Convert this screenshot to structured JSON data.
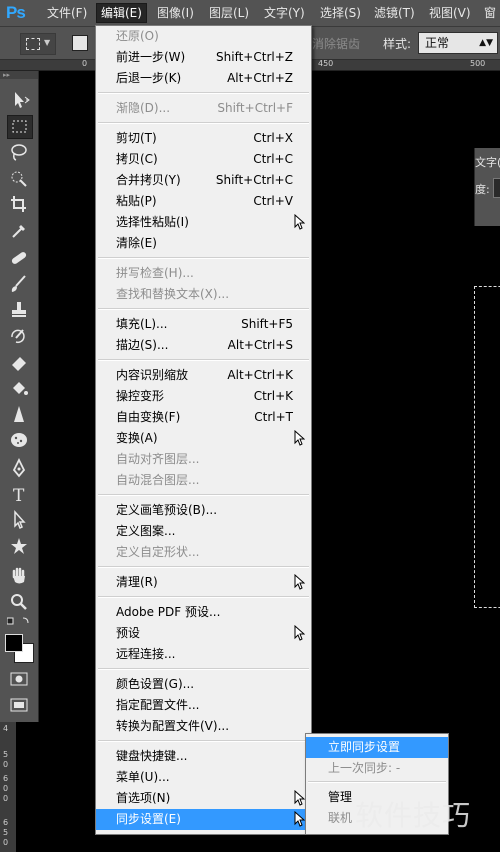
{
  "app": {
    "logo": "Ps"
  },
  "menubar": {
    "items": [
      {
        "label": "文件(F)"
      },
      {
        "label": "编辑(E)"
      },
      {
        "label": "图像(I)"
      },
      {
        "label": "图层(L)"
      },
      {
        "label": "文字(Y)"
      },
      {
        "label": "选择(S)"
      },
      {
        "label": "滤镜(T)"
      },
      {
        "label": "视图(V)"
      },
      {
        "label": "窗"
      }
    ],
    "active": "编辑(E)"
  },
  "options_bar": {
    "antialias_label": "消除锯齿",
    "style_label": "样式:",
    "style_value": "正常"
  },
  "ruler": {
    "marks": [
      "0",
      "450",
      "500"
    ]
  },
  "vertical_ruler": {
    "marks": [
      "4",
      "5",
      "0",
      "6",
      "0",
      "0",
      "6",
      "5",
      "0"
    ]
  },
  "panel_stub": {
    "title": "文字(",
    "field_label": "度:"
  },
  "edit_menu": {
    "items": [
      {
        "label": "还原(O)",
        "shortcut": "",
        "disabled": true
      },
      {
        "label": "前进一步(W)",
        "shortcut": "Shift+Ctrl+Z",
        "disabled": false
      },
      {
        "label": "后退一步(K)",
        "shortcut": "Alt+Ctrl+Z",
        "disabled": false
      },
      {
        "label": "渐隐(D)...",
        "shortcut": "Shift+Ctrl+F",
        "disabled": true
      },
      {
        "label": "剪切(T)",
        "shortcut": "Ctrl+X",
        "disabled": false
      },
      {
        "label": "拷贝(C)",
        "shortcut": "Ctrl+C",
        "disabled": false
      },
      {
        "label": "合并拷贝(Y)",
        "shortcut": "Shift+Ctrl+C",
        "disabled": false
      },
      {
        "label": "粘贴(P)",
        "shortcut": "Ctrl+V",
        "disabled": false
      },
      {
        "label": "选择性粘贴(I)",
        "shortcut": "",
        "disabled": false,
        "submenu": true
      },
      {
        "label": "清除(E)",
        "shortcut": "",
        "disabled": false
      },
      {
        "label": "拼写检查(H)...",
        "shortcut": "",
        "disabled": true
      },
      {
        "label": "查找和替换文本(X)...",
        "shortcut": "",
        "disabled": true
      },
      {
        "label": "填充(L)...",
        "shortcut": "Shift+F5",
        "disabled": false
      },
      {
        "label": "描边(S)...",
        "shortcut": "Alt+Ctrl+S",
        "disabled": false
      },
      {
        "label": "内容识别缩放",
        "shortcut": "Alt+Ctrl+K",
        "disabled": false
      },
      {
        "label": "操控变形",
        "shortcut": "Ctrl+K",
        "disabled": false
      },
      {
        "label": "自由变换(F)",
        "shortcut": "Ctrl+T",
        "disabled": false
      },
      {
        "label": "变换(A)",
        "shortcut": "",
        "disabled": false,
        "submenu": true
      },
      {
        "label": "自动对齐图层...",
        "shortcut": "",
        "disabled": true
      },
      {
        "label": "自动混合图层...",
        "shortcut": "",
        "disabled": true
      },
      {
        "label": "定义画笔预设(B)...",
        "shortcut": "",
        "disabled": false
      },
      {
        "label": "定义图案...",
        "shortcut": "",
        "disabled": false
      },
      {
        "label": "定义自定形状...",
        "shortcut": "",
        "disabled": true
      },
      {
        "label": "清理(R)",
        "shortcut": "",
        "disabled": false,
        "submenu": true
      },
      {
        "label": "Adobe PDF 预设...",
        "shortcut": "",
        "disabled": false
      },
      {
        "label": "预设",
        "shortcut": "",
        "disabled": false,
        "submenu": true
      },
      {
        "label": "远程连接...",
        "shortcut": "",
        "disabled": false
      },
      {
        "label": "颜色设置(G)...",
        "shortcut": "",
        "disabled": false
      },
      {
        "label": "指定配置文件...",
        "shortcut": "",
        "disabled": false
      },
      {
        "label": "转换为配置文件(V)...",
        "shortcut": "",
        "disabled": false
      },
      {
        "label": "键盘快捷键...",
        "shortcut": "",
        "disabled": false
      },
      {
        "label": "菜单(U)...",
        "shortcut": "",
        "disabled": false
      },
      {
        "label": "首选项(N)",
        "shortcut": "",
        "disabled": false,
        "submenu": true
      },
      {
        "label": "同步设置(E)",
        "shortcut": "",
        "disabled": false,
        "submenu": true,
        "highlighted": true
      }
    ]
  },
  "sync_submenu": {
    "items": [
      {
        "label": "立即同步设置",
        "highlighted": true,
        "disabled": false
      },
      {
        "label": "上一次同步: -",
        "highlighted": false,
        "disabled": true
      },
      {
        "label": "管理",
        "highlighted": false,
        "disabled": false
      },
      {
        "label": "联机",
        "highlighted": false,
        "disabled": true
      }
    ]
  },
  "watermark": {
    "text": "软件技巧"
  },
  "colors": {
    "highlight": "#3399ff",
    "menu_bg": "#f0f0f0",
    "chrome": "#535353",
    "logo": "#31a8ff"
  }
}
